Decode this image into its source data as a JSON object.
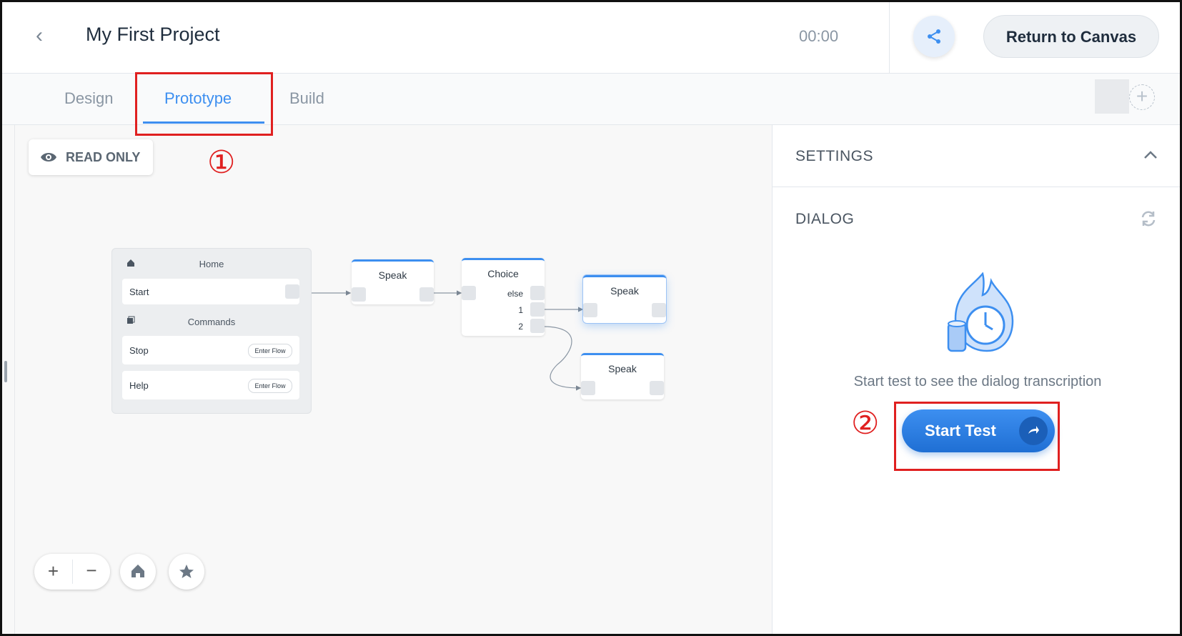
{
  "header": {
    "title": "My First Project",
    "timer": "00:00",
    "return_label": "Return to Canvas"
  },
  "tabs": [
    {
      "label": "Design"
    },
    {
      "label": "Prototype"
    },
    {
      "label": "Build"
    }
  ],
  "annotations": {
    "step1": "①",
    "step2": "②",
    "highlight_color": "#e02020"
  },
  "canvas": {
    "readonly_label": "READ ONLY",
    "home_block": {
      "title": "Home",
      "start": "Start",
      "commands_title": "Commands",
      "commands": [
        {
          "label": "Stop",
          "action": "Enter Flow"
        },
        {
          "label": "Help",
          "action": "Enter Flow"
        }
      ]
    },
    "nodes": {
      "speak1": "Speak",
      "choice": "Choice",
      "choice_ports": [
        "else",
        "1",
        "2"
      ],
      "speak2": "Speak",
      "speak3": "Speak"
    },
    "controls": [
      "zoom-in",
      "zoom-out",
      "home",
      "star"
    ]
  },
  "panel": {
    "settings_label": "SETTINGS",
    "dialog_label": "DIALOG",
    "hint": "Start test to see the dialog transcription",
    "start_label": "Start Test"
  },
  "colors": {
    "accent": "#3d8ff0",
    "accent_dark": "#1f6fd4"
  }
}
